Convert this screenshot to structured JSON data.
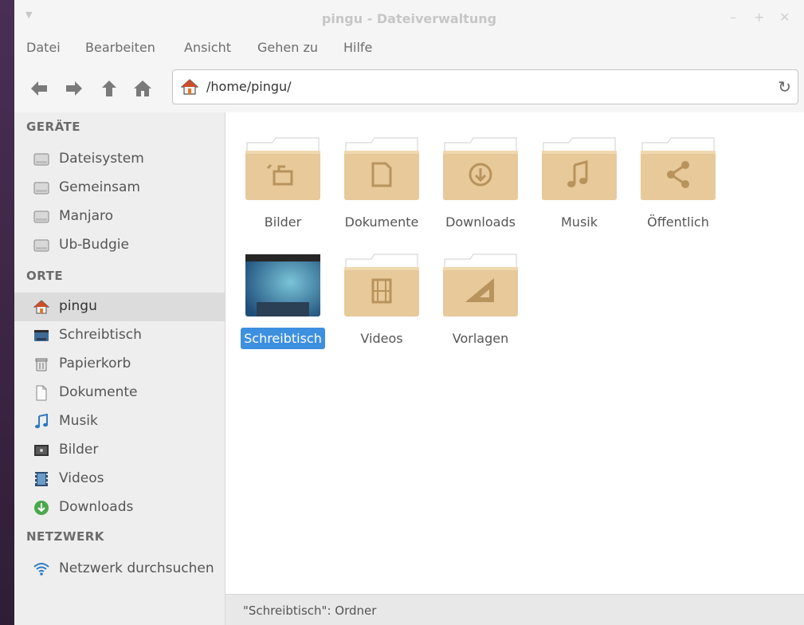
{
  "window": {
    "title": "pingu - Dateiverwaltung"
  },
  "menubar": [
    "Datei",
    "Bearbeiten",
    "Ansicht",
    "Gehen zu",
    "Hilfe"
  ],
  "location": {
    "path": "/home/pingu/"
  },
  "sidebar": {
    "devices_header": "GERÄTE",
    "devices": [
      {
        "label": "Dateisystem",
        "icon": "drive-icon"
      },
      {
        "label": "Gemeinsam",
        "icon": "drive-icon"
      },
      {
        "label": "Manjaro",
        "icon": "drive-icon"
      },
      {
        "label": "Ub-Budgie",
        "icon": "drive-icon"
      }
    ],
    "places_header": "ORTE",
    "places": [
      {
        "label": "pingu",
        "icon": "home-icon"
      },
      {
        "label": "Schreibtisch",
        "icon": "desktop-icon"
      },
      {
        "label": "Papierkorb",
        "icon": "trash-icon"
      },
      {
        "label": "Dokumente",
        "icon": "document-icon"
      },
      {
        "label": "Musik",
        "icon": "music-icon"
      },
      {
        "label": "Bilder",
        "icon": "pictures-icon"
      },
      {
        "label": "Videos",
        "icon": "video-icon"
      },
      {
        "label": "Downloads",
        "icon": "download-icon"
      }
    ],
    "network_header": "NETZWERK",
    "network": [
      {
        "label": "Netzwerk durchsuchen",
        "icon": "wifi-icon"
      }
    ]
  },
  "files": [
    {
      "name": "Bilder",
      "icon": "pictures-folder-icon"
    },
    {
      "name": "Dokumente",
      "icon": "documents-folder-icon"
    },
    {
      "name": "Downloads",
      "icon": "downloads-folder-icon"
    },
    {
      "name": "Musik",
      "icon": "music-folder-icon"
    },
    {
      "name": "Öffentlich",
      "icon": "public-folder-icon"
    },
    {
      "name": "Schreibtisch",
      "icon": "desktop-folder-icon"
    },
    {
      "name": "Videos",
      "icon": "videos-folder-icon"
    },
    {
      "name": "Vorlagen",
      "icon": "templates-folder-icon"
    }
  ],
  "statusbar": {
    "text": "\"Schreibtisch\": Ordner"
  },
  "colors": {
    "folder": "#e7c99a",
    "folder_dark": "#b8935c",
    "selection": "#3d8fe0",
    "active_sidebar": "#dcdcdc"
  }
}
